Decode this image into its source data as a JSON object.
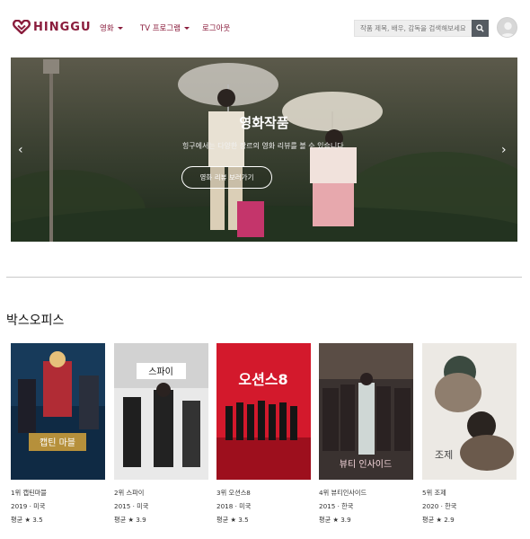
{
  "brand": {
    "name": "HINGGU",
    "color": "#8a1c3c"
  },
  "nav": {
    "movies_label": "영화",
    "tv_label": "TV 프로그램",
    "logout_label": "로그아웃"
  },
  "search": {
    "placeholder": "작품 제목, 배우, 감독을 검색해보세요."
  },
  "hero": {
    "title": "영화작품",
    "subtitle": "힝구에서는 다양한 장르의 영화 리뷰를 볼 수 있습니다.",
    "button_label": "영화 리뷰 보러가기",
    "prev_icon": "chevron-left-icon",
    "next_icon": "chevron-right-icon"
  },
  "box_office": {
    "title": "박스오피스",
    "movies": [
      {
        "title": "1위 캡틴마블",
        "meta": "2019 · 미국",
        "rating": "평균 ★ 3.5",
        "poster_text": "캡틴 마블"
      },
      {
        "title": "2위 스파이",
        "meta": "2015 · 미국",
        "rating": "평균 ★ 3.9",
        "poster_text": "스파이"
      },
      {
        "title": "3위 오션스8",
        "meta": "2018 · 미국",
        "rating": "평균 ★ 3.5",
        "poster_text": "오션스8"
      },
      {
        "title": "4위 뷰티인사이드",
        "meta": "2015 · 한국",
        "rating": "평균 ★ 3.9",
        "poster_text": "뷰티 인사이드"
      },
      {
        "title": "5위 조제",
        "meta": "2020 · 한국",
        "rating": "평균 ★ 2.9",
        "poster_text": "조제"
      }
    ]
  }
}
